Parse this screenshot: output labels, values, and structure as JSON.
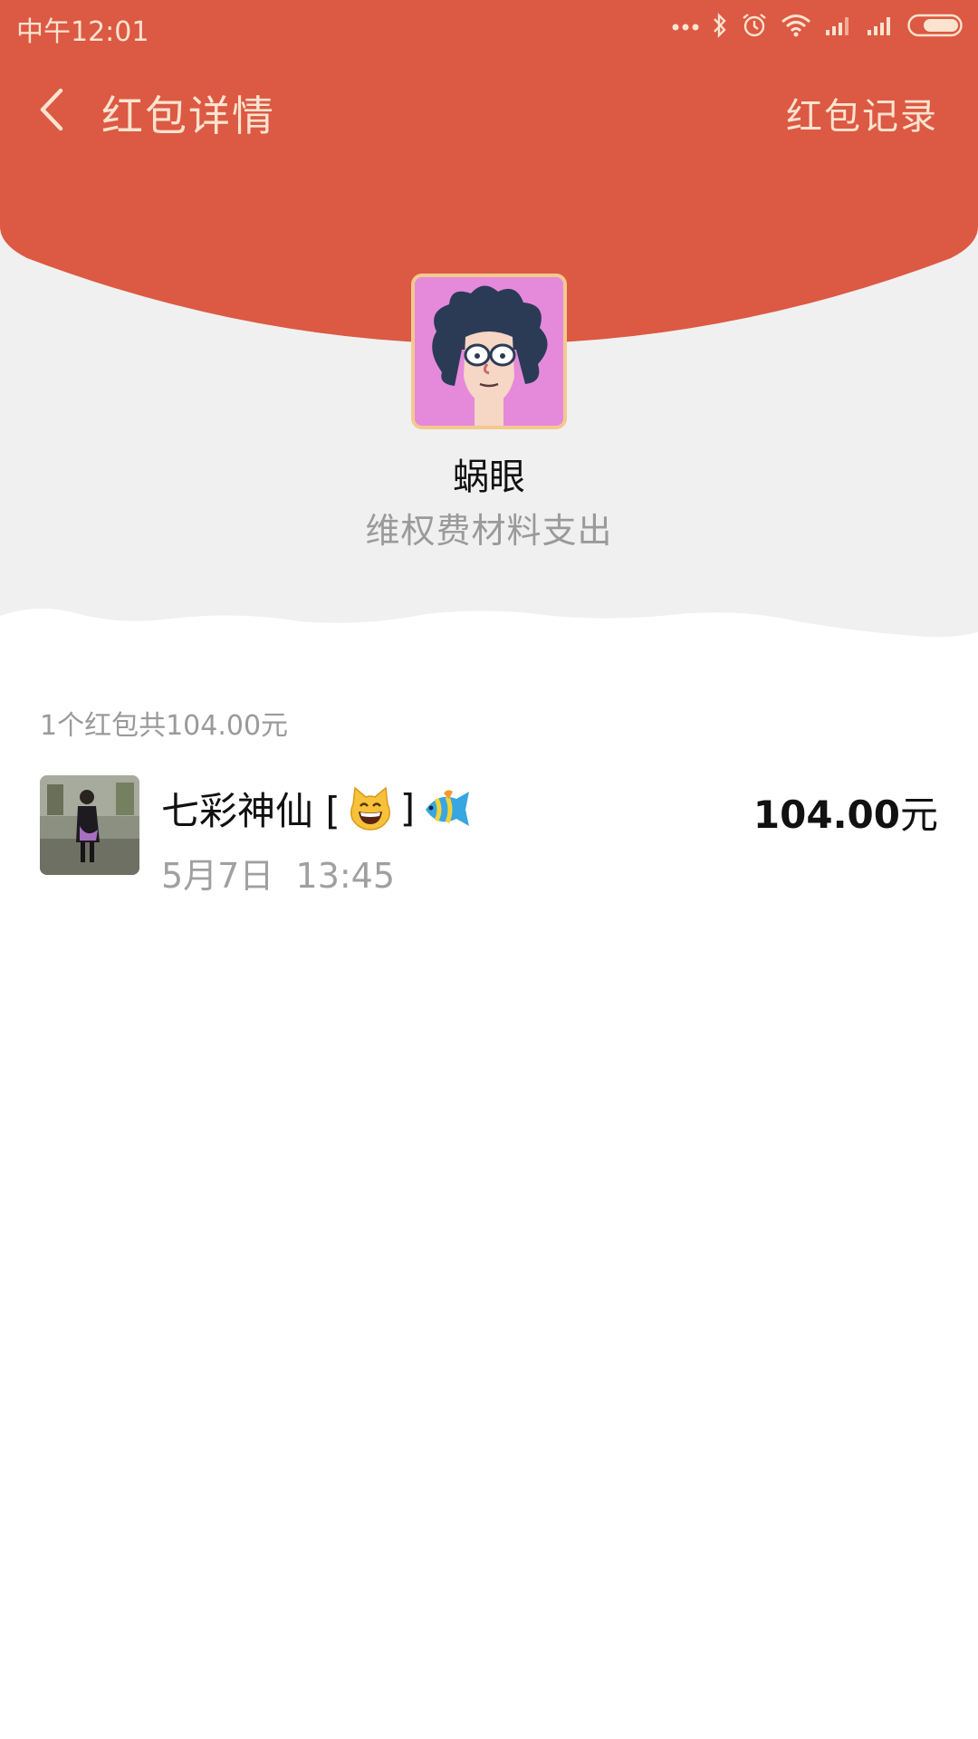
{
  "status_bar": {
    "time": "中午12:01",
    "icons": [
      "more-dots-icon",
      "bluetooth-icon",
      "alarm-icon",
      "wifi-icon",
      "signal-icon",
      "signal-icon",
      "battery-icon"
    ]
  },
  "nav": {
    "back_icon": "chevron-left-icon",
    "title": "红包详情",
    "records_label": "红包记录"
  },
  "sender": {
    "avatar_icon": "cartoon-avatar",
    "name": "蜗眼",
    "greeting": "维权费材料支出"
  },
  "summary_text": "1个红包共104.00元",
  "records": [
    {
      "name_text": "七彩神仙 [",
      "name_suffix": "]",
      "emojis": [
        "grinning-cat-emoji",
        "tropical-fish-emoji"
      ],
      "time": "5月7日  13:45",
      "amount": "104.00",
      "unit": "元"
    }
  ],
  "colors": {
    "header_red": "#dc5943",
    "header_text": "#fbe3cf",
    "page_grey": "#f1f0f0",
    "avatar_border": "#f3c98f"
  }
}
